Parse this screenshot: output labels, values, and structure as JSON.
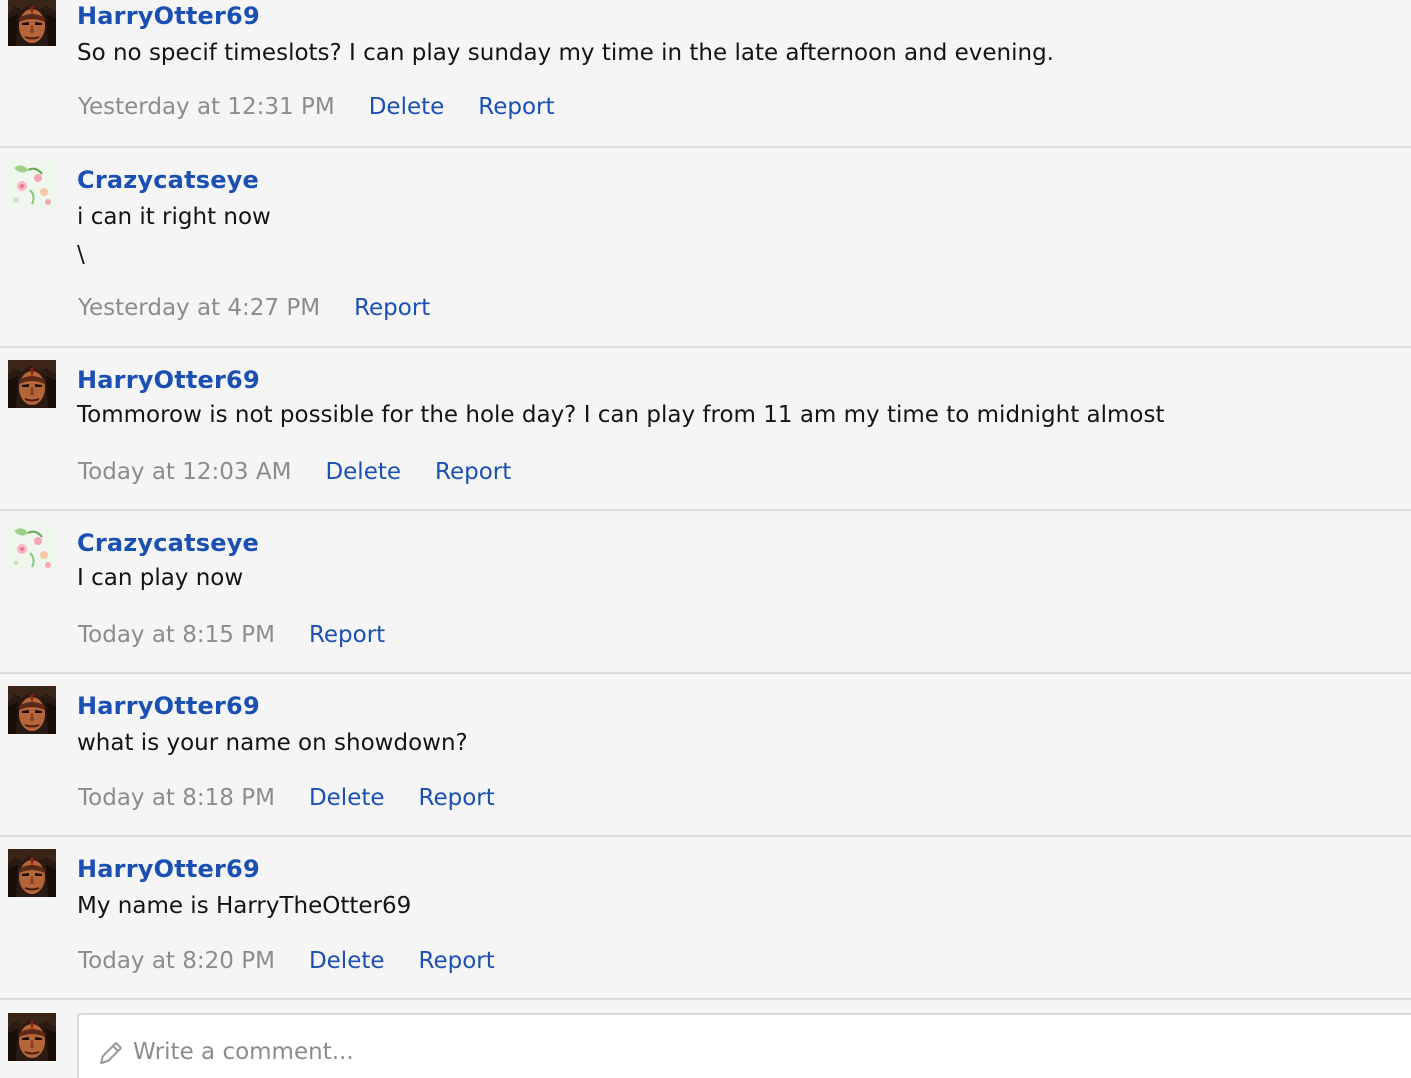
{
  "comments": [
    {
      "author": "HarryOtter69",
      "avatar": "harry-avatar",
      "text": "So no specif timeslots? I can play sunday my time in the late afternoon and evening.",
      "time": "Yesterday at 12:31 PM",
      "delete_label": "Delete",
      "report_label": "Report"
    },
    {
      "author": "Crazycatseye",
      "avatar": "cat-avatar",
      "text": "i can it right now\n\\",
      "time": "Yesterday at 4:27 PM",
      "report_label": "Report"
    },
    {
      "author": "HarryOtter69",
      "avatar": "harry-avatar",
      "text": "Tommorow is not possible for the hole day? I can play from 11 am my time to midnight almost",
      "time": "Today at 12:03 AM",
      "delete_label": "Delete",
      "report_label": "Report"
    },
    {
      "author": "Crazycatseye",
      "avatar": "cat-avatar",
      "text": "I can play now",
      "time": "Today at 8:15 PM",
      "report_label": "Report"
    },
    {
      "author": "HarryOtter69",
      "avatar": "harry-avatar",
      "text": "what is your name on showdown?",
      "time": "Today at 8:18 PM",
      "delete_label": "Delete",
      "report_label": "Report"
    },
    {
      "author": "HarryOtter69",
      "avatar": "harry-avatar",
      "text": "My name is HarryTheOtter69",
      "time": "Today at 8:20 PM",
      "delete_label": "Delete",
      "report_label": "Report"
    }
  ],
  "composer": {
    "placeholder": "Write a comment...",
    "icon": "pencil-icon",
    "avatar": "harry-avatar"
  },
  "colors": {
    "link": "#1a4fb4",
    "timestamp": "#8c8c8c",
    "background": "#f5f5f5",
    "divider": "#dcdcdc"
  }
}
